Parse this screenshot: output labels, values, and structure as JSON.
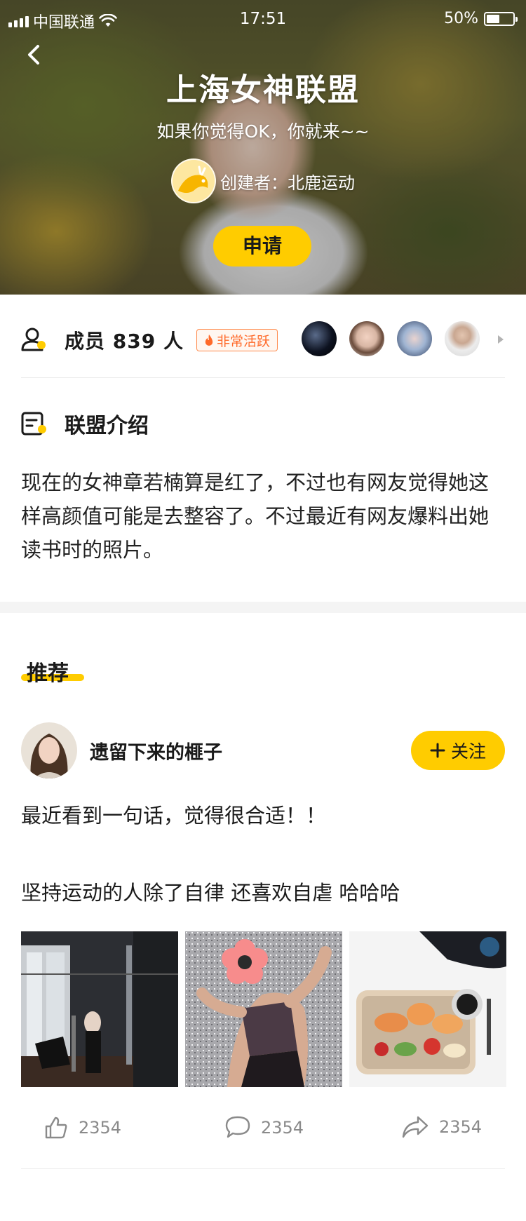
{
  "status_bar": {
    "carrier": "中国联通",
    "time": "17:51",
    "battery": "50%",
    "battery_fraction": 0.5
  },
  "group": {
    "title": "上海女神联盟",
    "slogan": "如果你觉得OK，你就来~~",
    "creator_label": "创建者：北鹿运动",
    "apply_label": "申请"
  },
  "members": {
    "count_text": "成员 839 人",
    "activity_tag": "非常活跃"
  },
  "intro": {
    "title": "联盟介绍",
    "text": "现在的女神章若楠算是红了，不过也有网友觉得她这样高颜值可能是去整容了。不过最近有网友爆料出她读书时的照片。"
  },
  "recommend": {
    "title": "推荐",
    "post": {
      "username": "遗留下来的榧子",
      "follow_label": "关注",
      "text_line1": "最近看到一句话，觉得很合适！！",
      "text_line2": "坚持运动的人除了自律  还喜欢自虐 哈哈哈",
      "likes": "2354",
      "comments": "2354",
      "shares": "2354"
    }
  },
  "colors": {
    "accent": "#ffcc00",
    "active_tag": "#ff6a2a"
  },
  "icons": [
    "back-arrow-icon",
    "members-icon",
    "fire-icon",
    "intro-icon",
    "plus-icon",
    "like-icon",
    "comment-icon",
    "share-icon",
    "more-arrow-icon"
  ]
}
